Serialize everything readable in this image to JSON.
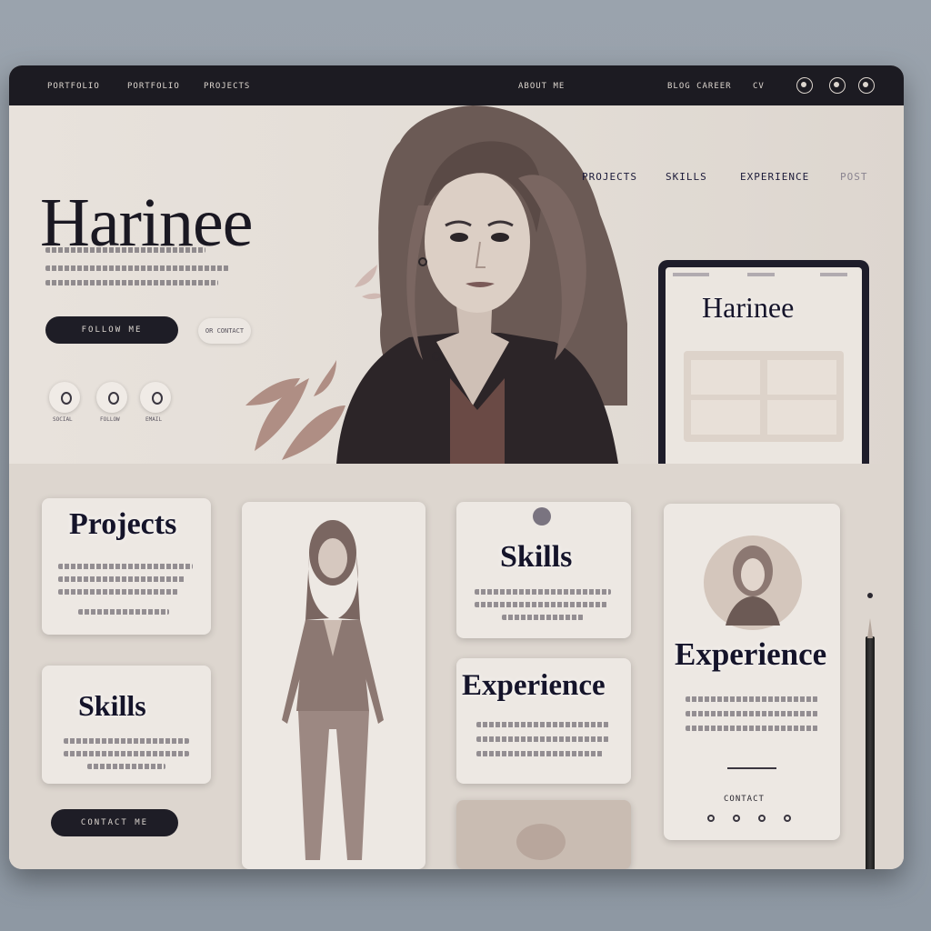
{
  "topbar": {
    "nav_left": [
      "PORTFOLIO",
      "PORTFOLIO",
      "PROJECTS"
    ],
    "nav_center": "ABOUT ME",
    "nav_right": [
      "BLOG CAREER",
      "CV"
    ]
  },
  "hero": {
    "title": "Harinee",
    "nav": [
      "PROJECTS",
      "SKILLS",
      "EXPERIENCE",
      "POST"
    ],
    "cta_primary": "FOLLOW ME",
    "cta_secondary": "OR CONTACT",
    "social_labels": [
      "SOCIAL",
      "FOLLOW",
      "EMAIL"
    ]
  },
  "tablet": {
    "title": "Harinee"
  },
  "sections": {
    "projects_title": "Projects",
    "skills_title": "Skills",
    "skills_center_title": "Skills",
    "experience_center_title": "Experience",
    "experience_right_title": "Experience",
    "contact_button": "CONTACT ME",
    "contact_label": "CONTACT"
  },
  "colors": {
    "dark": "#1c1b22",
    "bg": "#e6e0da",
    "accent": "#8a6a60"
  }
}
